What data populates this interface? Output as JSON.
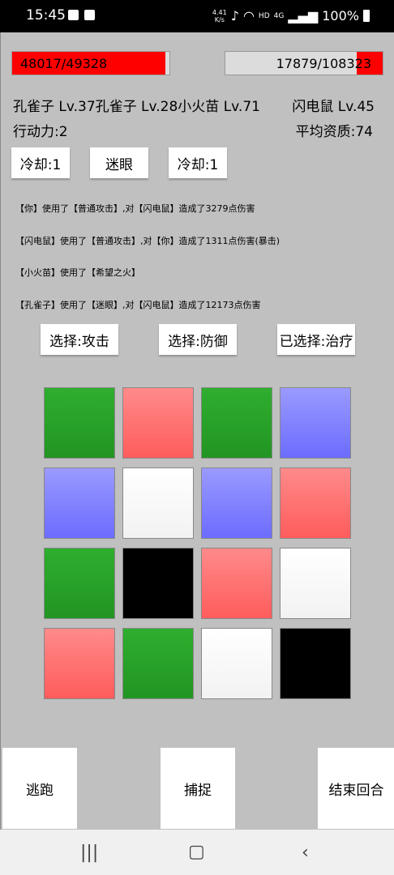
{
  "status": {
    "time": "15:45",
    "speed_value": "4.41",
    "speed_unit": "K/s",
    "hd": "HD",
    "net": "4G",
    "battery": "100%"
  },
  "player_hp": {
    "text": "48017/49328",
    "current": 48017,
    "max": 49328
  },
  "enemy_hp": {
    "text": "17879/108323",
    "current": 17879,
    "max": 108323
  },
  "team_line": "孔雀子 Lv.37孔雀子 Lv.28小火苗 Lv.71",
  "enemy_line": "闪电鼠 Lv.45",
  "action_points": "行动力:2",
  "avg_quality": "平均资质:74",
  "skills": [
    "冷却:1",
    "迷眼",
    "冷却:1"
  ],
  "battle_log": [
    "【你】使用了【普通攻击】,对【闪电鼠】造成了3279点伤害",
    "【闪电鼠】使用了【普通攻击】,对【你】造成了1311点伤害(暴击)",
    "【小火苗】使用了【希望之火】",
    "【孔雀子】使用了【迷眼】,对【闪电鼠】造成了12173点伤害"
  ],
  "choices": [
    "选择:攻击",
    "选择:防御",
    "已选择:治疗"
  ],
  "grid": [
    [
      "green",
      "red",
      "green",
      "blue"
    ],
    [
      "blue",
      "white",
      "blue",
      "red"
    ],
    [
      "green",
      "black",
      "red",
      "white"
    ],
    [
      "red",
      "green",
      "white",
      "black"
    ]
  ],
  "actions": {
    "escape": "逃跑",
    "capture": "捕捉",
    "end_turn": "结束回合"
  },
  "colors": {
    "hp": "#ff0000",
    "background": "#c0c0c0",
    "green": "#2fae2f",
    "red": "#ff7070",
    "blue": "#8585ff"
  }
}
